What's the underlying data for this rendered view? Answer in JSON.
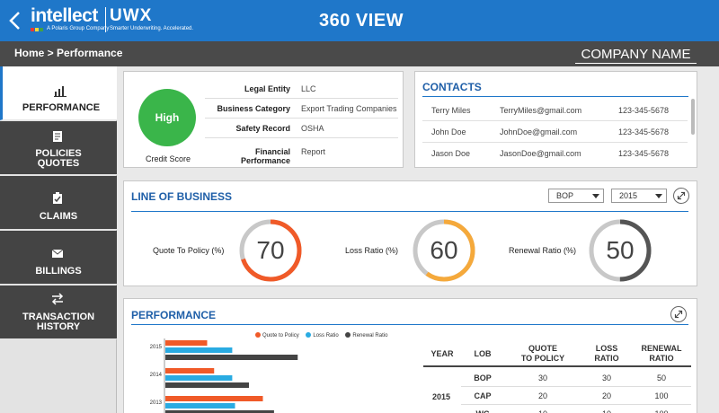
{
  "header": {
    "logo": "intellect",
    "logo_sub": "A Polaris Group Company",
    "product": "UWX",
    "product_sub": "Smarter Underwriting. Accelerated.",
    "title": "360 VIEW"
  },
  "subbar": {
    "breadcrumb": "Home >  Performance",
    "company": "COMPANY NAME"
  },
  "sidebar": {
    "items": [
      {
        "label_lines": [
          "PERFORMANCE"
        ],
        "icon": "bar-chart-icon",
        "active": true
      },
      {
        "label_lines": [
          "POLICIES",
          "QUOTES"
        ],
        "icon": "document-icon",
        "active": false
      },
      {
        "label_lines": [
          "CLAIMS"
        ],
        "icon": "clipboard-icon",
        "active": false
      },
      {
        "label_lines": [
          "BILLINGS"
        ],
        "icon": "envelope-icon",
        "active": false
      },
      {
        "label_lines": [
          "TRANSACTION",
          "HISTORY"
        ],
        "icon": "transfer-arrows-icon",
        "active": false
      }
    ]
  },
  "credit": {
    "score": "High",
    "label": "Credit Score",
    "color": "#3ab54a",
    "rows": [
      {
        "key": "Legal Entity",
        "value": "LLC"
      },
      {
        "key": "Business Category",
        "value": "Export Trading Companies"
      },
      {
        "key": "Safety Record",
        "value": "OSHA"
      },
      {
        "key": "Financial Performance",
        "value": "Report"
      }
    ]
  },
  "contacts": {
    "title": "CONTACTS",
    "rows": [
      {
        "name": "Terry Miles",
        "email": "TerryMiles@gmail.com",
        "phone": "123-345-5678"
      },
      {
        "name": "John Doe",
        "email": "JohnDoe@gmail.com",
        "phone": "123-345-5678"
      },
      {
        "name": "Jason Doe",
        "email": "JasonDoe@gmail.com",
        "phone": "123-345-5678"
      }
    ]
  },
  "lob": {
    "title": "LINE OF BUSINESS",
    "lob_select": "BOP",
    "year_select": "2015",
    "gauges": [
      {
        "label": "Quote To Policy (%)",
        "value": 70,
        "color": "#f05a28"
      },
      {
        "label": "Loss Ratio (%)",
        "value": 60,
        "color": "#f5a93b"
      },
      {
        "label": "Renewal Ratio (%)",
        "value": 50,
        "color": "#555555"
      }
    ]
  },
  "performance": {
    "title": "PERFORMANCE",
    "legend": [
      {
        "name": "Quote to Policy",
        "color": "#f05a28"
      },
      {
        "name": "Loss Ratio",
        "color": "#29abe2"
      },
      {
        "name": "Renewal Ratio",
        "color": "#444444"
      }
    ],
    "table": {
      "headers": [
        "YEAR",
        "LOB",
        "QUOTE\nTO POLICY",
        "LOSS\nRATIO",
        "RENEWAL\nRATIO"
      ],
      "year": "2015",
      "rows": [
        {
          "lob": "BOP",
          "quote": "30",
          "loss": "30",
          "renewal": "50"
        },
        {
          "lob": "CAP",
          "quote": "20",
          "loss": "20",
          "renewal": "100"
        },
        {
          "lob": "WC",
          "quote": "10",
          "loss": "10",
          "renewal": "100"
        }
      ]
    }
  },
  "chart_data": {
    "type": "bar",
    "orientation": "horizontal",
    "categories": [
      "2015",
      "2014",
      "2013"
    ],
    "series": [
      {
        "name": "Quote to Policy",
        "values": [
          30,
          35,
          70
        ]
      },
      {
        "name": "Loss Ratio",
        "values": [
          48,
          48,
          50
        ]
      },
      {
        "name": "Renewal Ratio",
        "values": [
          95,
          60,
          78
        ]
      }
    ],
    "legend": "top",
    "grid": false
  }
}
